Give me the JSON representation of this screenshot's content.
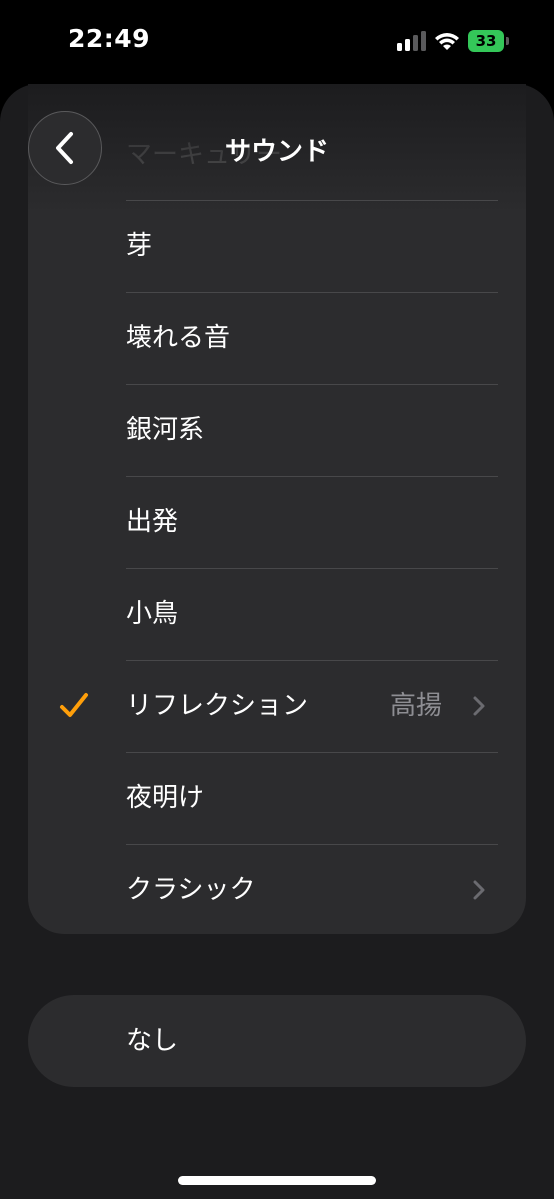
{
  "status_bar": {
    "time": "22:49",
    "battery": "33"
  },
  "header": {
    "title": "サウンド",
    "partially_hidden_item": "マーキュリー"
  },
  "sounds": [
    {
      "label": "芽",
      "selected": false,
      "value": "",
      "chevron": false
    },
    {
      "label": "壊れる音",
      "selected": false,
      "value": "",
      "chevron": false
    },
    {
      "label": "銀河系",
      "selected": false,
      "value": "",
      "chevron": false
    },
    {
      "label": "出発",
      "selected": false,
      "value": "",
      "chevron": false
    },
    {
      "label": "小鳥",
      "selected": false,
      "value": "",
      "chevron": false
    },
    {
      "label": "リフレクション",
      "selected": true,
      "value": "高揚",
      "chevron": true
    },
    {
      "label": "夜明け",
      "selected": false,
      "value": "",
      "chevron": false
    },
    {
      "label": "クラシック",
      "selected": false,
      "value": "",
      "chevron": true
    }
  ],
  "none_option": {
    "label": "なし"
  },
  "colors": {
    "background": "#000000",
    "sheet": "#1c1c1e",
    "card": "#2c2c2e",
    "accent": "#ff9f0a",
    "secondary_text": "#8e8e93",
    "battery": "#34c759"
  },
  "icons": {
    "back": "chevron-left-icon",
    "check": "checkmark-icon",
    "disclosure": "chevron-right-icon"
  }
}
